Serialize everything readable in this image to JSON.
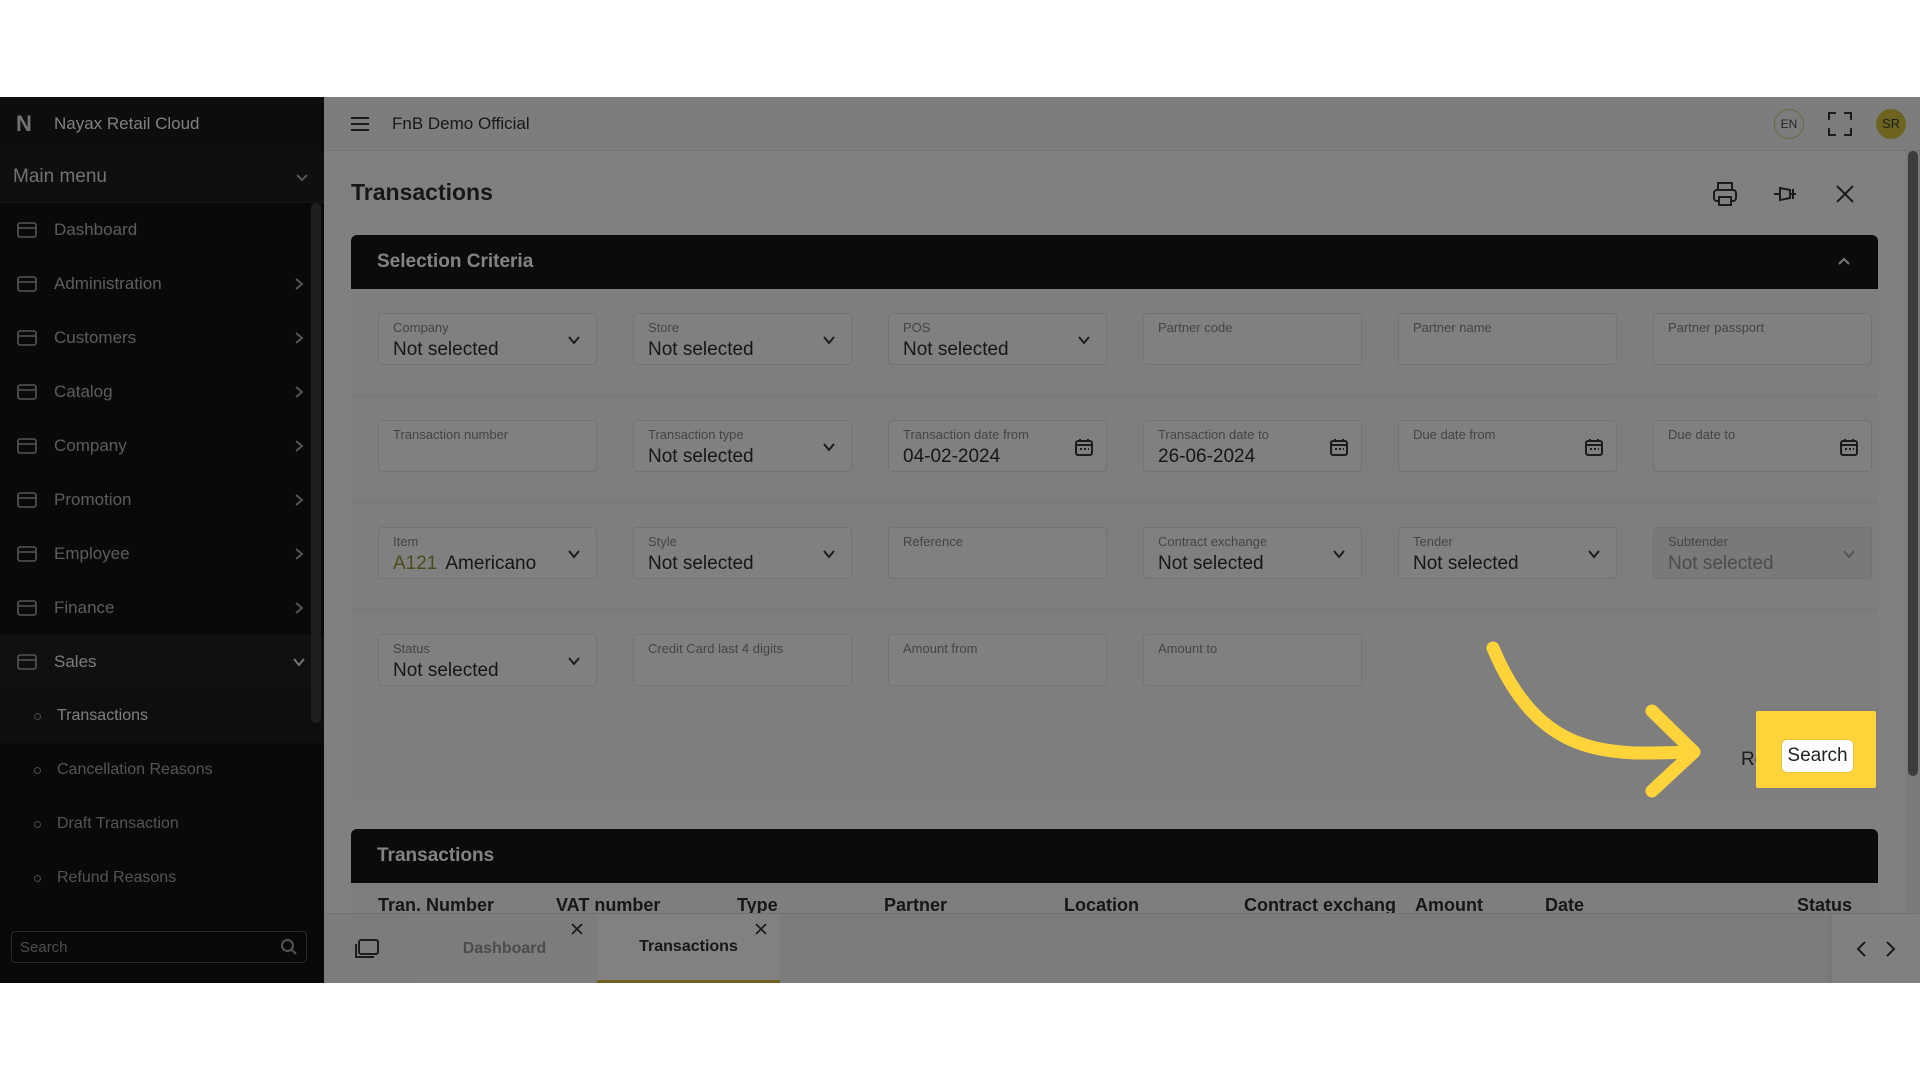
{
  "app": {
    "brand": "Nayax Retail Cloud",
    "brand_mark": "N",
    "org": "FnB Demo Official",
    "lang": "EN",
    "avatar": "SR"
  },
  "sidebar": {
    "main_menu": "Main menu",
    "items": [
      {
        "label": "Dashboard",
        "icon": "dashboard-icon"
      },
      {
        "label": "Administration",
        "icon": "admin-icon"
      },
      {
        "label": "Customers",
        "icon": "customers-icon"
      },
      {
        "label": "Catalog",
        "icon": "catalog-icon"
      },
      {
        "label": "Company",
        "icon": "company-icon"
      },
      {
        "label": "Promotion",
        "icon": "star-icon"
      },
      {
        "label": "Employee",
        "icon": "employee-icon"
      },
      {
        "label": "Finance",
        "icon": "finance-icon"
      },
      {
        "label": "Sales",
        "icon": "sales-icon"
      }
    ],
    "sub_items": [
      "Transactions",
      "Cancellation Reasons",
      "Draft Transaction",
      "Refund Reasons"
    ],
    "search_placeholder": "Search"
  },
  "page": {
    "title": "Transactions"
  },
  "criteria": {
    "title": "Selection Criteria",
    "rows": [
      [
        {
          "label": "Company",
          "value": "Not selected",
          "kind": "select"
        },
        {
          "label": "Store",
          "value": "Not selected",
          "kind": "select"
        },
        {
          "label": "POS",
          "value": "Not selected",
          "kind": "select"
        },
        {
          "label": "Partner code",
          "value": "",
          "kind": "text"
        },
        {
          "label": "Partner name",
          "value": "",
          "kind": "text"
        },
        {
          "label": "Partner passport",
          "value": "",
          "kind": "text"
        }
      ],
      [
        {
          "label": "Transaction number",
          "value": "",
          "kind": "text"
        },
        {
          "label": "Transaction type",
          "value": "Not selected",
          "kind": "select"
        },
        {
          "label": "Transaction date from",
          "value": "04-02-2024",
          "kind": "date"
        },
        {
          "label": "Transaction date to",
          "value": "26-06-2024",
          "kind": "date"
        },
        {
          "label": "Due date from",
          "value": "",
          "kind": "date"
        },
        {
          "label": "Due date to",
          "value": "",
          "kind": "date"
        }
      ],
      [
        {
          "label": "Item",
          "code": "A121",
          "value": "Americano",
          "kind": "select"
        },
        {
          "label": "Style",
          "value": "Not selected",
          "kind": "select"
        },
        {
          "label": "Reference",
          "value": "",
          "kind": "text"
        },
        {
          "label": "Contract exchange",
          "value": "Not selected",
          "kind": "select"
        },
        {
          "label": "Tender",
          "value": "Not selected",
          "kind": "select"
        },
        {
          "label": "Subtender",
          "value": "Not selected",
          "kind": "select",
          "disabled": true
        }
      ],
      [
        {
          "label": "Status",
          "value": "Not selected",
          "kind": "select"
        },
        {
          "label": "Credit Card last 4 digits",
          "value": "",
          "kind": "text"
        },
        {
          "label": "Amount from",
          "value": "",
          "kind": "text"
        },
        {
          "label": "Amount to",
          "value": "",
          "kind": "text"
        }
      ]
    ],
    "reset_label": "Rese",
    "search_label": "Search"
  },
  "results": {
    "title": "Transactions",
    "columns": [
      "Tran. Number",
      "VAT number",
      "Type",
      "Partner",
      "Location",
      "Contract exchang",
      "Amount",
      "Date",
      "Status"
    ]
  },
  "tabs": [
    {
      "label": "Dashboard",
      "active": false
    },
    {
      "label": "Transactions",
      "active": true
    }
  ],
  "colors": {
    "highlight": "#ffd43b",
    "accent": "#c8b23a",
    "sidebar": "#121212"
  }
}
